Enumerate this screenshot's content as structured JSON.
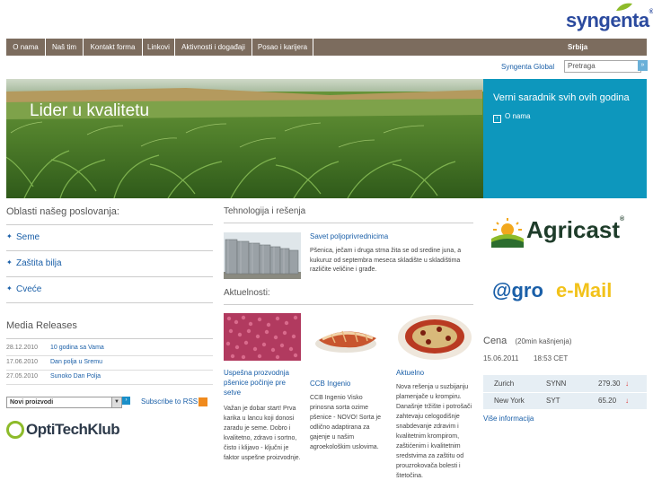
{
  "brand": {
    "name": "syngenta",
    "reg": "®"
  },
  "nav": {
    "items": [
      "O nama",
      "Naš tim",
      "Kontakt forma",
      "Linkovi",
      "Aktivnosti i događaji",
      "Posao i karijera"
    ],
    "region": "Srbija"
  },
  "header": {
    "global_link": "Syngenta Global",
    "search_placeholder": "Pretraga",
    "search_button": "»"
  },
  "hero": {
    "title": "Lider u kvalitetu",
    "promo_title": "Verni saradnik svih ovih godina",
    "promo_link": "O nama"
  },
  "areas": {
    "title": "Oblasti našeg poslovanja:",
    "items": [
      "Seme",
      "Zaštita bilja",
      "Cveće"
    ]
  },
  "media": {
    "title": "Media Releases",
    "items": [
      {
        "date": "28.12.2010",
        "title": "10 godina sa Vama"
      },
      {
        "date": "17.06.2010",
        "title": "Dan polja u Sremu"
      },
      {
        "date": "27.05.2010",
        "title": "Sunoko Dan Polja"
      }
    ],
    "select_value": "Novi proizvodi",
    "rss_label": "Subscribe to RSS"
  },
  "optitech": {
    "label": "OptiTechKlub"
  },
  "tech": {
    "title": "Tehnologija i rešenja",
    "link": "Savet poljoprivrednicima",
    "text": "Pšenica, ječam i druga strna žita se od sredine juna, a kukuruz od septembra meseca skladište u skladištima različite veličine i građe."
  },
  "news": {
    "title": "Aktuelnosti:",
    "items": [
      {
        "title": "Uspešna prozvodnja pšenice počinje pre setve",
        "body": "Važan je dobar start! Prva karika u lancu koji donosi zaradu je seme. Dobro i kvalitetno, zdravo i sortno, čisto i klijavo - ključni je faktor uspešne proizvodnje."
      },
      {
        "title": "CCB Ingenio",
        "body": "CCB Ingenio Visko prinosna sorta ozime pšenice - NOVO! Sorta je odlično adaptirana za gajenje u našim agroekološkim uslovima."
      },
      {
        "title": "Aktuelno",
        "body": "Nova rešenja u suzbijanju plamenjače u krompiru. Današnje tržište i potrošači zahtevaju celogodišnje snabdevanje zdravim i kvalitetnim krompirom, zaštićenim i kvalitetnim sredstvima za zaštitu od prouzrokovača bolesti i štetočina."
      }
    ]
  },
  "right": {
    "agricast": "Agricast",
    "agricast_reg": "®",
    "email_prefix": "@gro",
    "email_suffix": "e-Mail"
  },
  "price": {
    "title": "Cena",
    "subtitle": "(20min kašnjenja)",
    "date": "15.06.2011",
    "time": "18:53 CET",
    "rows": [
      {
        "city": "Zurich",
        "symbol": "SYNN",
        "value": "279.30",
        "arrow": "↓"
      },
      {
        "city": "New York",
        "symbol": "SYT",
        "value": "65.20",
        "arrow": "↓"
      }
    ],
    "more": "Više informacija"
  },
  "colors": {
    "nav_bg": "#7c6c5e",
    "promo_bg": "#0d97bd",
    "link": "#1a5fa8",
    "brand": "#2b4a9e"
  }
}
